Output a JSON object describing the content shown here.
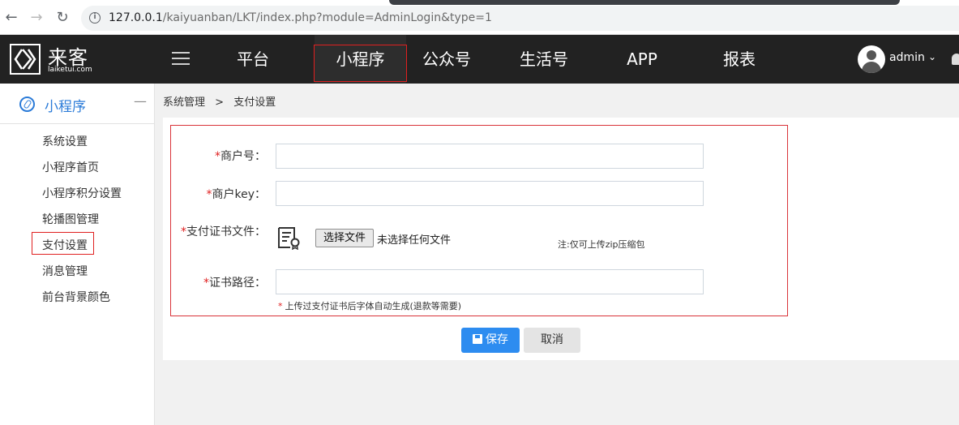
{
  "browser": {
    "url_host": "127.0.0.1",
    "url_path": "/kaiyuanban/LKT/index.php?module=AdminLogin&type=1"
  },
  "header": {
    "logo_title": "来客",
    "logo_sub": "laiketui.com",
    "nav": [
      "平台",
      "小程序",
      "公众号",
      "生活号",
      "APP",
      "报表"
    ],
    "active_nav": "小程序",
    "user_name": "admin"
  },
  "sidebar": {
    "section_title": "小程序",
    "collapse_symbol": "—",
    "items": [
      "系统设置",
      "小程序首页",
      "小程序积分设置",
      "轮播图管理",
      "支付设置",
      "消息管理",
      "前台背景颜色"
    ],
    "selected": "支付设置"
  },
  "breadcrumb": {
    "parent": "系统管理",
    "separator": ">",
    "current": "支付设置"
  },
  "form": {
    "required_mark": "*",
    "merchant_id_label": "商户号：",
    "merchant_id_value": "",
    "merchant_key_label": "商户key：",
    "merchant_key_value": "",
    "cert_file_label": "支付证书文件：",
    "file_button_label": "选择文件",
    "file_status": "未选择任何文件",
    "zip_note": "注:仅可上传zip压缩包",
    "cert_path_label": "证书路径：",
    "cert_path_value": "",
    "cert_path_hint": "上传过支付证书后字体自动生成(退款等需要)"
  },
  "actions": {
    "save_label": "保存",
    "cancel_label": "取消"
  },
  "colors": {
    "header_bg": "#222222",
    "accent_blue": "#2d8cf0",
    "sidebar_accent": "#2b7bd8",
    "highlight_red": "#e02020"
  }
}
